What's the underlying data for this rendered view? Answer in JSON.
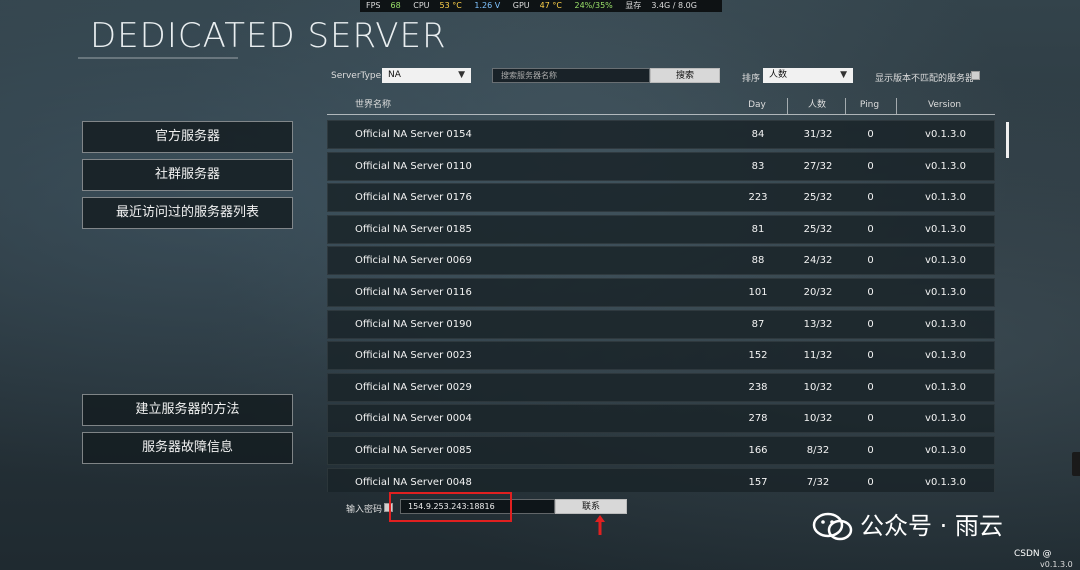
{
  "overlay": {
    "fps_label": "FPS",
    "fps": "68",
    "cpu_label": "CPU",
    "cpu_temp": "53 °C",
    "cpu_volt": "1.26 V",
    "gpu_label": "GPU",
    "gpu_temp": "47 °C",
    "gpu_usage": "24%/35%",
    "mem_label": "显存",
    "mem": "3.4G / 8.0G"
  },
  "title": "DEDICATED SERVER",
  "left_menu": {
    "official": "官方服务器",
    "community": "社群服务器",
    "recent": "最近访问过的服务器列表",
    "howto": "建立服务器的方法",
    "troubleshoot": "服务器故障信息"
  },
  "filters": {
    "server_type_label": "ServerType",
    "server_type_value": "NA",
    "search_placeholder": "搜索服务器名称",
    "search_button": "搜索",
    "sort_label": "排序",
    "sort_value": "人数",
    "show_mismatch_label": "显示版本不匹配的服务器"
  },
  "table": {
    "headers": {
      "name": "世界名称",
      "day": "Day",
      "players": "人数",
      "ping": "Ping",
      "version": "Version"
    },
    "rows": [
      {
        "name": "Official NA Server 0154",
        "day": "84",
        "players": "31/32",
        "ping": "0",
        "version": "v0.1.3.0"
      },
      {
        "name": "Official NA Server 0110",
        "day": "83",
        "players": "27/32",
        "ping": "0",
        "version": "v0.1.3.0"
      },
      {
        "name": "Official NA Server 0176",
        "day": "223",
        "players": "25/32",
        "ping": "0",
        "version": "v0.1.3.0"
      },
      {
        "name": "Official NA Server 0185",
        "day": "81",
        "players": "25/32",
        "ping": "0",
        "version": "v0.1.3.0"
      },
      {
        "name": "Official NA Server 0069",
        "day": "88",
        "players": "24/32",
        "ping": "0",
        "version": "v0.1.3.0"
      },
      {
        "name": "Official NA Server 0116",
        "day": "101",
        "players": "20/32",
        "ping": "0",
        "version": "v0.1.3.0"
      },
      {
        "name": "Official NA Server 0190",
        "day": "87",
        "players": "13/32",
        "ping": "0",
        "version": "v0.1.3.0"
      },
      {
        "name": "Official NA Server 0023",
        "day": "152",
        "players": "11/32",
        "ping": "0",
        "version": "v0.1.3.0"
      },
      {
        "name": "Official NA Server 0029",
        "day": "238",
        "players": "10/32",
        "ping": "0",
        "version": "v0.1.3.0"
      },
      {
        "name": "Official NA Server 0004",
        "day": "278",
        "players": "10/32",
        "ping": "0",
        "version": "v0.1.3.0"
      },
      {
        "name": "Official NA Server 0085",
        "day": "166",
        "players": "8/32",
        "ping": "0",
        "version": "v0.1.3.0"
      },
      {
        "name": "Official NA Server 0048",
        "day": "157",
        "players": "7/32",
        "ping": "0",
        "version": "v0.1.3.0"
      }
    ]
  },
  "connect": {
    "password_label": "输入密码",
    "address_value": "154.9.253.243:18816",
    "connect_button": "联系"
  },
  "watermark": "公众号 · 雨云",
  "csdn": "CSDN @",
  "game_version": "v0.1.3.0",
  "colors": {
    "annotation_red": "#e02020",
    "row_bg": "#1a2429"
  }
}
